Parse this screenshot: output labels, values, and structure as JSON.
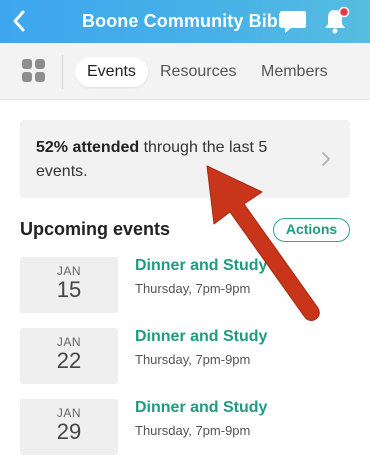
{
  "header": {
    "title": "Boone Community Bible",
    "back_icon": "chevron-left-icon",
    "chat_icon": "chat-bubble-icon",
    "bell_icon": "bell-icon",
    "notification_dot_color": "#e8383d"
  },
  "tabs": {
    "grid_icon": "grid-icon",
    "items": [
      {
        "label": "Events",
        "active": true
      },
      {
        "label": "Resources",
        "active": false
      },
      {
        "label": "Members",
        "active": false
      }
    ]
  },
  "attendance": {
    "highlight": "52% attended",
    "rest": " through the last 5 events.",
    "chevron_icon": "chevron-right-icon"
  },
  "upcoming": {
    "title": "Upcoming events",
    "actions_label": "Actions",
    "events": [
      {
        "month": "JAN",
        "day": "15",
        "title": "Dinner and Study",
        "when": "Thursday, 7pm-9pm"
      },
      {
        "month": "JAN",
        "day": "22",
        "title": "Dinner and Study",
        "when": "Thursday, 7pm-9pm"
      },
      {
        "month": "JAN",
        "day": "29",
        "title": "Dinner and Study",
        "when": "Thursday, 7pm-9pm"
      }
    ]
  },
  "colors": {
    "header_blue": "#3da6ef",
    "accent_green": "#1f9c80",
    "annotation_arrow": "#c8351a"
  },
  "annotation": {
    "icon": "red-arrow-annotation"
  }
}
